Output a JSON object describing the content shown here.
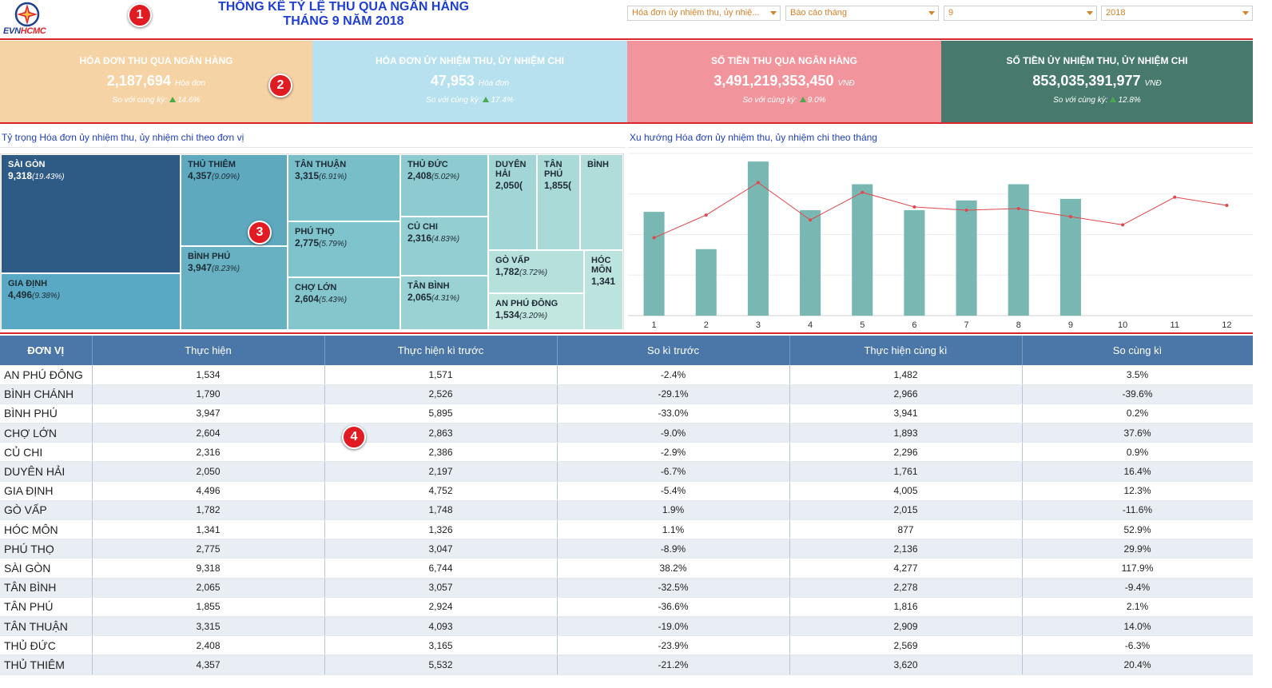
{
  "header": {
    "logo_text_a": "EVN",
    "logo_text_b": "HCMC",
    "title_line1": "THỐNG KÊ TỶ LỆ THU QUA NGÂN HÀNG",
    "title_line2": "THÁNG 9 NĂM 2018",
    "filters": [
      {
        "value": "Hóa đơn ủy nhiệm thu, ủy nhiệ..."
      },
      {
        "value": "Báo cáo tháng"
      },
      {
        "value": "9"
      },
      {
        "value": "2018"
      }
    ]
  },
  "badges": [
    "1",
    "2",
    "3",
    "4"
  ],
  "kpis": [
    {
      "title": "HÓA ĐƠN THU QUA NGÂN HÀNG",
      "value": "2,187,694",
      "unit": "Hóa đơn",
      "compare_label": "So với cùng kỳ:",
      "compare_value": "14.6%",
      "bg": "#f6d3a4",
      "fg": "#ffffff"
    },
    {
      "title": "HÓA ĐƠN ỦY NHIỆM THU, ỦY NHIỆM CHI",
      "value": "47,953",
      "unit": "Hóa đơn",
      "compare_label": "So với cùng kỳ:",
      "compare_value": "17.4%",
      "bg": "#b7e1ee",
      "fg": "#ffffff"
    },
    {
      "title": "SỐ TIỀN THU QUA NGÂN HÀNG",
      "value": "3,491,219,353,450",
      "unit": "VNĐ",
      "compare_label": "So với cùng kỳ:",
      "compare_value": "9.0%",
      "bg": "#f1949c",
      "fg": "#ffffff"
    },
    {
      "title": "SỐ TIỀN ỦY NHIỆM THU, ỦY NHIỆM CHI",
      "value": "853,035,391,977",
      "unit": "VNĐ",
      "compare_label": "So với cùng kỳ:",
      "compare_value": "12.8%",
      "bg": "#477a6c",
      "fg": "#ffffff"
    }
  ],
  "treemap": {
    "title": "Tỷ trọng Hóa đơn ủy nhiệm thu, ủy nhiệm chi theo đơn vị",
    "cells": [
      {
        "name": "SÀI GÒN",
        "value": "9,318",
        "pct": "(19.43%)",
        "color": "#2e5a86",
        "dark": true
      },
      {
        "name": "GIA ĐỊNH",
        "value": "4,496",
        "pct": "(9.38%)",
        "color": "#5aa9c4",
        "dark": false
      },
      {
        "name": "THỦ THIÊM",
        "value": "4,357",
        "pct": "(9.09%)",
        "color": "#5ea9be",
        "dark": false
      },
      {
        "name": "BÌNH PHÚ",
        "value": "3,947",
        "pct": "(8.23%)",
        "color": "#68b1c2",
        "dark": false
      },
      {
        "name": "TÂN THUẬN",
        "value": "3,315",
        "pct": "(6.91%)",
        "color": "#77bec9",
        "dark": false
      },
      {
        "name": "PHÚ THỌ",
        "value": "2,775",
        "pct": "(5.79%)",
        "color": "#7fc3cc",
        "dark": false
      },
      {
        "name": "CHỢ LỚN",
        "value": "2,604",
        "pct": "(5.43%)",
        "color": "#85c6cd",
        "dark": false
      },
      {
        "name": "THỦ ĐỨC",
        "value": "2,408",
        "pct": "(5.02%)",
        "color": "#8dcbd0",
        "dark": false
      },
      {
        "name": "CỦ CHI",
        "value": "2,316",
        "pct": "(4.83%)",
        "color": "#93ced2",
        "dark": false
      },
      {
        "name": "TÂN BÌNH",
        "value": "2,065",
        "pct": "(4.31%)",
        "color": "#9ad2d4",
        "dark": false
      },
      {
        "name": "DUYÊN HẢI",
        "value": "2,050(",
        "pct": "",
        "color": "#a2d6d6",
        "dark": false
      },
      {
        "name": "TÂN PHÚ",
        "value": "1,855(",
        "pct": "",
        "color": "#aadad8",
        "dark": false
      },
      {
        "name": "BÌNH",
        "value": "",
        "pct": "",
        "color": "#b0ddda",
        "dark": false
      },
      {
        "name": "GÒ VẤP",
        "value": "1,782",
        "pct": "(3.72%)",
        "color": "#b5e0db",
        "dark": false
      },
      {
        "name": "HÓC MÔN",
        "value": "1,341",
        "pct": "",
        "color": "#bde3de",
        "dark": false
      },
      {
        "name": "AN PHÚ ĐÔNG",
        "value": "1,534",
        "pct": "(3.20%)",
        "color": "#c2e6e0",
        "dark": false
      }
    ]
  },
  "trend": {
    "title": "Xu hướng Hóa đơn ủy nhiệm thu, ủy nhiệm chi theo tháng"
  },
  "chart_data": {
    "type": "bar",
    "categories": [
      "1",
      "2",
      "3",
      "4",
      "5",
      "6",
      "7",
      "8",
      "9",
      "10",
      "11",
      "12"
    ],
    "series": [
      {
        "name": "",
        "kind": "bar",
        "values": [
          0.64,
          0.41,
          0.95,
          0.65,
          0.81,
          0.65,
          0.71,
          0.81,
          0.72,
          null,
          null,
          null
        ],
        "color": "#79b8b2"
      },
      {
        "name": "",
        "kind": "line",
        "values": [
          0.48,
          0.62,
          0.82,
          0.59,
          0.76,
          0.67,
          0.65,
          0.66,
          0.61,
          0.56,
          0.73,
          0.68
        ],
        "color": "#e0474c"
      }
    ],
    "ylim": [
      0,
      1
    ],
    "grid": true
  },
  "table": {
    "headers": [
      "ĐƠN VỊ",
      "Thực hiện",
      "Thực hiện kì trước",
      "So kì trước",
      "Thực hiện cùng kì",
      "So cùng kì"
    ],
    "rows": [
      [
        "AN PHÚ ĐÔNG",
        "1,534",
        "1,571",
        "-2.4%",
        "1,482",
        "3.5%"
      ],
      [
        "BÌNH CHÁNH",
        "1,790",
        "2,526",
        "-29.1%",
        "2,966",
        "-39.6%"
      ],
      [
        "BÌNH PHÚ",
        "3,947",
        "5,895",
        "-33.0%",
        "3,941",
        "0.2%"
      ],
      [
        "CHỢ LỚN",
        "2,604",
        "2,863",
        "-9.0%",
        "1,893",
        "37.6%"
      ],
      [
        "CỦ CHI",
        "2,316",
        "2,386",
        "-2.9%",
        "2,296",
        "0.9%"
      ],
      [
        "DUYÊN HẢI",
        "2,050",
        "2,197",
        "-6.7%",
        "1,761",
        "16.4%"
      ],
      [
        "GIA ĐỊNH",
        "4,496",
        "4,752",
        "-5.4%",
        "4,005",
        "12.3%"
      ],
      [
        "GÒ VẤP",
        "1,782",
        "1,748",
        "1.9%",
        "2,015",
        "-11.6%"
      ],
      [
        "HÓC MÔN",
        "1,341",
        "1,326",
        "1.1%",
        "877",
        "52.9%"
      ],
      [
        "PHÚ THỌ",
        "2,775",
        "3,047",
        "-8.9%",
        "2,136",
        "29.9%"
      ],
      [
        "SÀI GÒN",
        "9,318",
        "6,744",
        "38.2%",
        "4,277",
        "117.9%"
      ],
      [
        "TÂN BÌNH",
        "2,065",
        "3,057",
        "-32.5%",
        "2,278",
        "-9.4%"
      ],
      [
        "TÂN PHÚ",
        "1,855",
        "2,924",
        "-36.6%",
        "1,816",
        "2.1%"
      ],
      [
        "TÂN THUẬN",
        "3,315",
        "4,093",
        "-19.0%",
        "2,909",
        "14.0%"
      ],
      [
        "THỦ ĐỨC",
        "2,408",
        "3,165",
        "-23.9%",
        "2,569",
        "-6.3%"
      ],
      [
        "THỦ THIÊM",
        "4,357",
        "5,532",
        "-21.2%",
        "3,620",
        "20.4%"
      ]
    ]
  }
}
